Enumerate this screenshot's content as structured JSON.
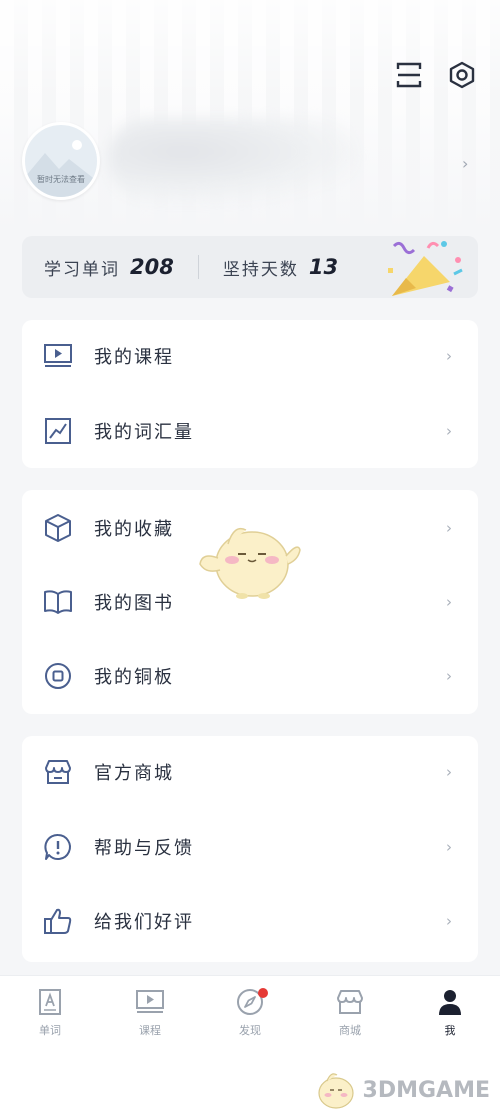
{
  "header": {
    "icons": [
      "scan-icon",
      "settings-icon"
    ]
  },
  "profile": {
    "avatar_caption": "暂时无法查看"
  },
  "stats": {
    "words_label": "学习单词",
    "words_value": "208",
    "days_label": "坚持天数",
    "days_value": "13"
  },
  "menu_group_1": {
    "items": [
      {
        "label": "我的课程",
        "icon": "video-icon"
      },
      {
        "label": "我的词汇量",
        "icon": "chart-icon"
      }
    ]
  },
  "menu_group_2": {
    "items": [
      {
        "label": "我的收藏",
        "icon": "cube-icon"
      },
      {
        "label": "我的图书",
        "icon": "book-icon"
      },
      {
        "label": "我的铜板",
        "icon": "coin-icon"
      }
    ]
  },
  "menu_group_3": {
    "items": [
      {
        "label": "官方商城",
        "icon": "store-icon"
      },
      {
        "label": "帮助与反馈",
        "icon": "help-icon"
      },
      {
        "label": "给我们好评",
        "icon": "thumbs-up-icon"
      }
    ]
  },
  "tabbar": {
    "items": [
      {
        "label": "单词",
        "icon": "word-icon",
        "active": false
      },
      {
        "label": "课程",
        "icon": "course-icon",
        "active": false
      },
      {
        "label": "发现",
        "icon": "compass-icon",
        "active": false,
        "badge": true
      },
      {
        "label": "商城",
        "icon": "store-icon",
        "active": false
      },
      {
        "label": "我",
        "icon": "person-icon",
        "active": true
      }
    ]
  },
  "watermark": {
    "text": "3DMGAME"
  },
  "colors": {
    "background": "#f5f6f8",
    "card": "#ffffff",
    "icon_blue": "#4a5f8f",
    "badge_red": "#e53935",
    "text_dark": "#1c2130"
  }
}
